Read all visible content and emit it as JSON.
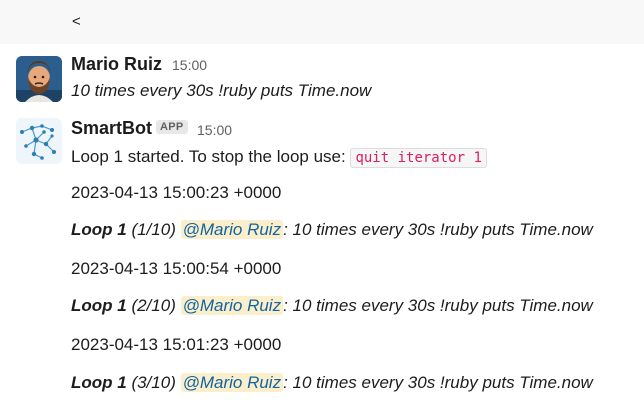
{
  "header": {
    "back_label": "<"
  },
  "messages": [
    {
      "author": "Mario Ruiz",
      "time": "15:00",
      "text": "10 times every 30s !ruby puts Time.now"
    },
    {
      "author": "SmartBot",
      "badge": "APP",
      "time": "15:00",
      "intro": "Loop 1 started. To stop the loop use: ",
      "code": "quit iterator 1",
      "lines": [
        {
          "timestamp": "2023-04-13 15:00:23 +0000"
        },
        {
          "loop": "Loop 1",
          "count": " (1/10) ",
          "mention": "@Mario Ruiz",
          "rest": ": 10 times every 30s !ruby puts Time.now"
        },
        {
          "timestamp": "2023-04-13 15:00:54 +0000"
        },
        {
          "loop": "Loop 1",
          "count": " (2/10) ",
          "mention": "@Mario Ruiz",
          "rest": ": 10 times every 30s !ruby puts Time.now"
        },
        {
          "timestamp": "2023-04-13 15:01:23 +0000"
        },
        {
          "loop": "Loop 1",
          "count": " (3/10) ",
          "mention": "@Mario Ruiz",
          "rest": ": 10 times every 30s !ruby puts Time.now"
        }
      ]
    }
  ],
  "colors": {
    "mention_bg": "#fbeecb",
    "mention_text": "#1264a3",
    "code_text": "#e01e5a"
  }
}
